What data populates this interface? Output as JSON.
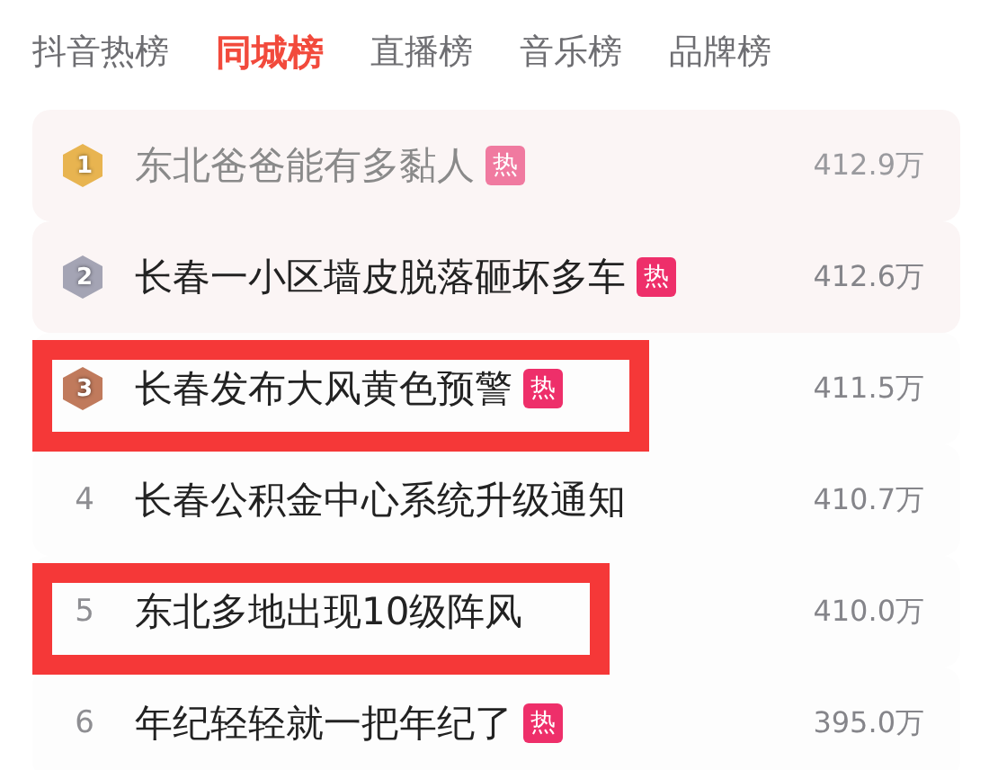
{
  "tabs": [
    {
      "label": "抖音热榜",
      "selected": false
    },
    {
      "label": "同城榜",
      "selected": true
    },
    {
      "label": "直播榜",
      "selected": false
    },
    {
      "label": "音乐榜",
      "selected": false
    },
    {
      "label": "品牌榜",
      "selected": false
    }
  ],
  "rows": [
    {
      "rank": "1",
      "kind": "medal",
      "color": "#e8b450",
      "title": "东北爸爸能有多黏人",
      "badge": "热",
      "heat": "412.9万",
      "faded": true,
      "highlighted": false
    },
    {
      "rank": "2",
      "kind": "medal",
      "color": "#a4a4b4",
      "title": "长春一小区墙皮脱落砸坏多车",
      "badge": "热",
      "heat": "412.6万",
      "faded": false,
      "highlighted": false
    },
    {
      "rank": "3",
      "kind": "medal",
      "color": "#c07a5c",
      "title": "长春发布大风黄色预警",
      "badge": "热",
      "heat": "411.5万",
      "faded": false,
      "highlighted": true
    },
    {
      "rank": "4",
      "kind": "plain",
      "title": "长春公积金中心系统升级通知",
      "heat": "410.7万",
      "faded": false,
      "highlighted": false
    },
    {
      "rank": "5",
      "kind": "plain",
      "title": "东北多地出现10级阵风",
      "heat": "410.0万",
      "faded": false,
      "highlighted": true
    },
    {
      "rank": "6",
      "kind": "plain",
      "title": "年纪轻轻就一把年纪了",
      "badge": "热",
      "heat": "395.0万",
      "faded": false,
      "highlighted": false
    }
  ]
}
